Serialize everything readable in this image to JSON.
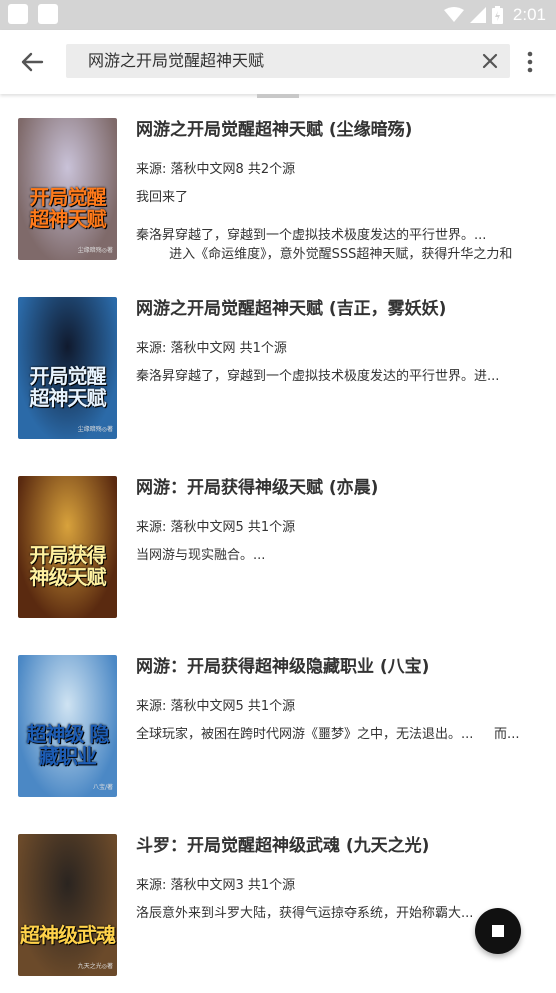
{
  "statusbar": {
    "time": "2:01"
  },
  "toolbar": {
    "search_value": "网游之开局觉醒超神天赋"
  },
  "results": [
    {
      "title": "网游之开局觉醒超神天赋 (尘缘暗殇)",
      "source": "来源: 落秋中文网8  共2个源",
      "intro": "我回来了\n\n秦洛昇穿越了，穿越到一个虚拟技术极度发达的平行世界。...\n        进入《命运维度》，意外觉醒SSS超神天赋，获得升华之力和",
      "cover_text": "开局觉醒\n超神天赋",
      "cover_author": "尘缘暗殇◎著"
    },
    {
      "title": "网游之开局觉醒超神天赋 (吉正，雾妖妖)",
      "source": "来源: 落秋中文网  共1个源",
      "intro": "秦洛昇穿越了，穿越到一个虚拟技术极度发达的平行世界。进...",
      "cover_text": "开局觉醒\n超神天赋",
      "cover_author": "尘缘暗殇◎著"
    },
    {
      "title": "网游：开局获得神级天赋 (亦晨)",
      "source": "来源: 落秋中文网5  共1个源",
      "intro": "当网游与现实融合。...",
      "cover_text": "开局获得\n神级天赋",
      "cover_author": ""
    },
    {
      "title": "网游：开局获得超神级隐藏职业 (八宝)",
      "source": "来源: 落秋中文网5  共1个源",
      "intro": "全球玩家，被困在跨时代网游《噩梦》之中，无法退出。...     而...",
      "cover_text": "超神级\n隐藏职业",
      "cover_author": "八宝/著"
    },
    {
      "title": "斗罗：开局觉醒超神级武魂 (九天之光)",
      "source": "来源: 落秋中文网3  共1个源",
      "intro": "洛辰意外来到斗罗大陆，获得气运掠夺系统，开始称霸大...",
      "cover_text": "超神级武魂",
      "cover_author": "九天之光◎著"
    }
  ],
  "covers": [
    {
      "bg": "#c9c2d8",
      "bg2": "#7f6a6a",
      "text": "#ff7a1a"
    },
    {
      "bg": "#101a2e",
      "bg2": "#2b6aa8",
      "text": "#e8f4ff"
    },
    {
      "bg": "#d8a23c",
      "bg2": "#5a2a10",
      "text": "#fff2a0"
    },
    {
      "bg": "#cfe3f2",
      "bg2": "#4b88c5",
      "text": "#1d5db5"
    },
    {
      "bg": "#2a2420",
      "bg2": "#6b4a2a",
      "text": "#ffd24a"
    }
  ]
}
